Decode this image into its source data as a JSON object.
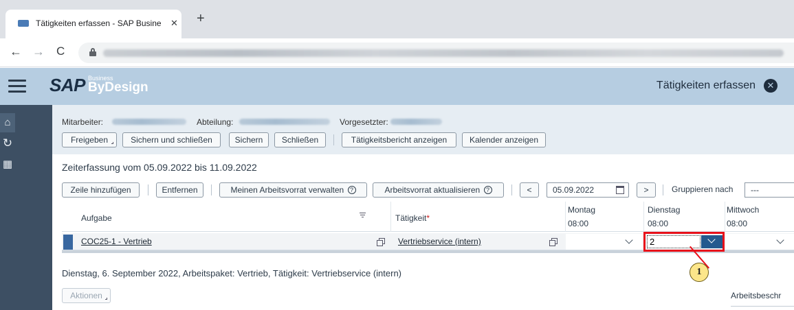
{
  "browser": {
    "tab_title": "Tätigkeiten erfassen - SAP Busine",
    "tab_close": "✕",
    "new_tab": "+",
    "back": "←",
    "forward": "→",
    "reload": "C"
  },
  "shell": {
    "logo_sap": "SAP",
    "logo_business": "Business",
    "logo_bydesign": "ByDesign",
    "title": "Tätigkeiten erfassen",
    "close": "✕"
  },
  "header": {
    "employee_label": "Mitarbeiter:",
    "department_label": "Abteilung:",
    "manager_label": "Vorgesetzter:"
  },
  "toolbar": {
    "release": "Freigeben",
    "save_close": "Sichern und schließen",
    "save": "Sichern",
    "close": "Schließen",
    "activity_report": "Tätigkeitsbericht anzeigen",
    "calendar": "Kalender anzeigen"
  },
  "section": {
    "title": "Zeiterfassung vom 05.09.2022 bis 11.09.2022"
  },
  "table_toolbar": {
    "add_row": "Zeile hinzufügen",
    "remove": "Entfernen",
    "manage_worklist": "Meinen Arbeitsvorrat verwalten",
    "refresh_worklist": "Arbeitsvorrat aktualisieren",
    "help": "?",
    "prev": "<",
    "next": ">",
    "date": "05.09.2022",
    "group_by_label": "Gruppieren nach",
    "group_by_value": "---"
  },
  "table": {
    "columns": {
      "task": "Aufgabe",
      "activity": "Tätigkeit",
      "required_marker": "*",
      "monday": "Montag",
      "monday_hours": "08:00",
      "tuesday": "Dienstag",
      "tuesday_hours": "08:00",
      "wednesday": "Mittwoch",
      "wednesday_hours": "08:00"
    },
    "rows": [
      {
        "task": "COC25-1 - Vertrieb",
        "activity": "Vertriebservice (intern)",
        "monday": "",
        "tuesday": "2",
        "wednesday": ""
      }
    ]
  },
  "callout": {
    "number": "1",
    "color": "#e8101a"
  },
  "detail": {
    "summary": "Dienstag, 6. September 2022, Arbeitspaket: Vertrieb, Tätigkeit: Vertriebservice (intern)",
    "actions": "Aktionen",
    "work_description": "Arbeitsbeschr"
  }
}
